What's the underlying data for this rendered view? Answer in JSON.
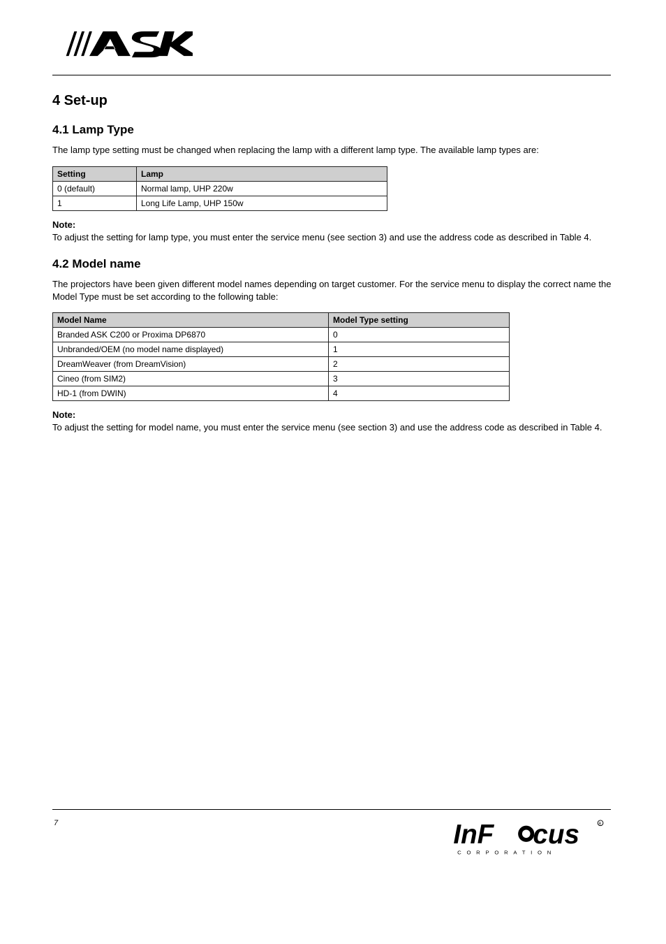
{
  "page_number": "7",
  "section": {
    "h1": "4 Set-up",
    "sub1": {
      "h2": "4.1 Lamp Type",
      "p": "The lamp type setting must be changed when replacing the lamp with a different lamp type. The available lamp types are:",
      "table": {
        "headers": [
          "Setting",
          "Lamp"
        ],
        "rows": [
          [
            "0 (default)",
            "Normal lamp, UHP 220w"
          ],
          [
            "1",
            "Long Life Lamp, UHP 150w"
          ]
        ]
      },
      "note_title": "Note:",
      "note_body": "To adjust the setting for lamp type, you must enter the service menu (see section 3) and use the address code as described in Table 4."
    },
    "sub2": {
      "h2": "4.2 Model name",
      "p": "The projectors have been given different model names depending on target customer. For the service menu to display the correct name the Model Type must be set according to the following table:",
      "table": {
        "headers": [
          "Model Name",
          "Model Type setting"
        ],
        "rows": [
          [
            "Branded ASK C200 or Proxima DP6870",
            "0"
          ],
          [
            "Unbranded/OEM (no model name displayed)",
            "1"
          ],
          [
            "DreamWeaver (from DreamVision)",
            "2"
          ],
          [
            "Cineo (from SIM2)",
            "3"
          ],
          [
            "HD-1 (from DWIN)",
            "4"
          ]
        ]
      },
      "note_title": "Note:",
      "note_body": "To adjust the setting for model name, you must enter the service menu (see section 3) and use the address code as described in Table 4."
    }
  }
}
